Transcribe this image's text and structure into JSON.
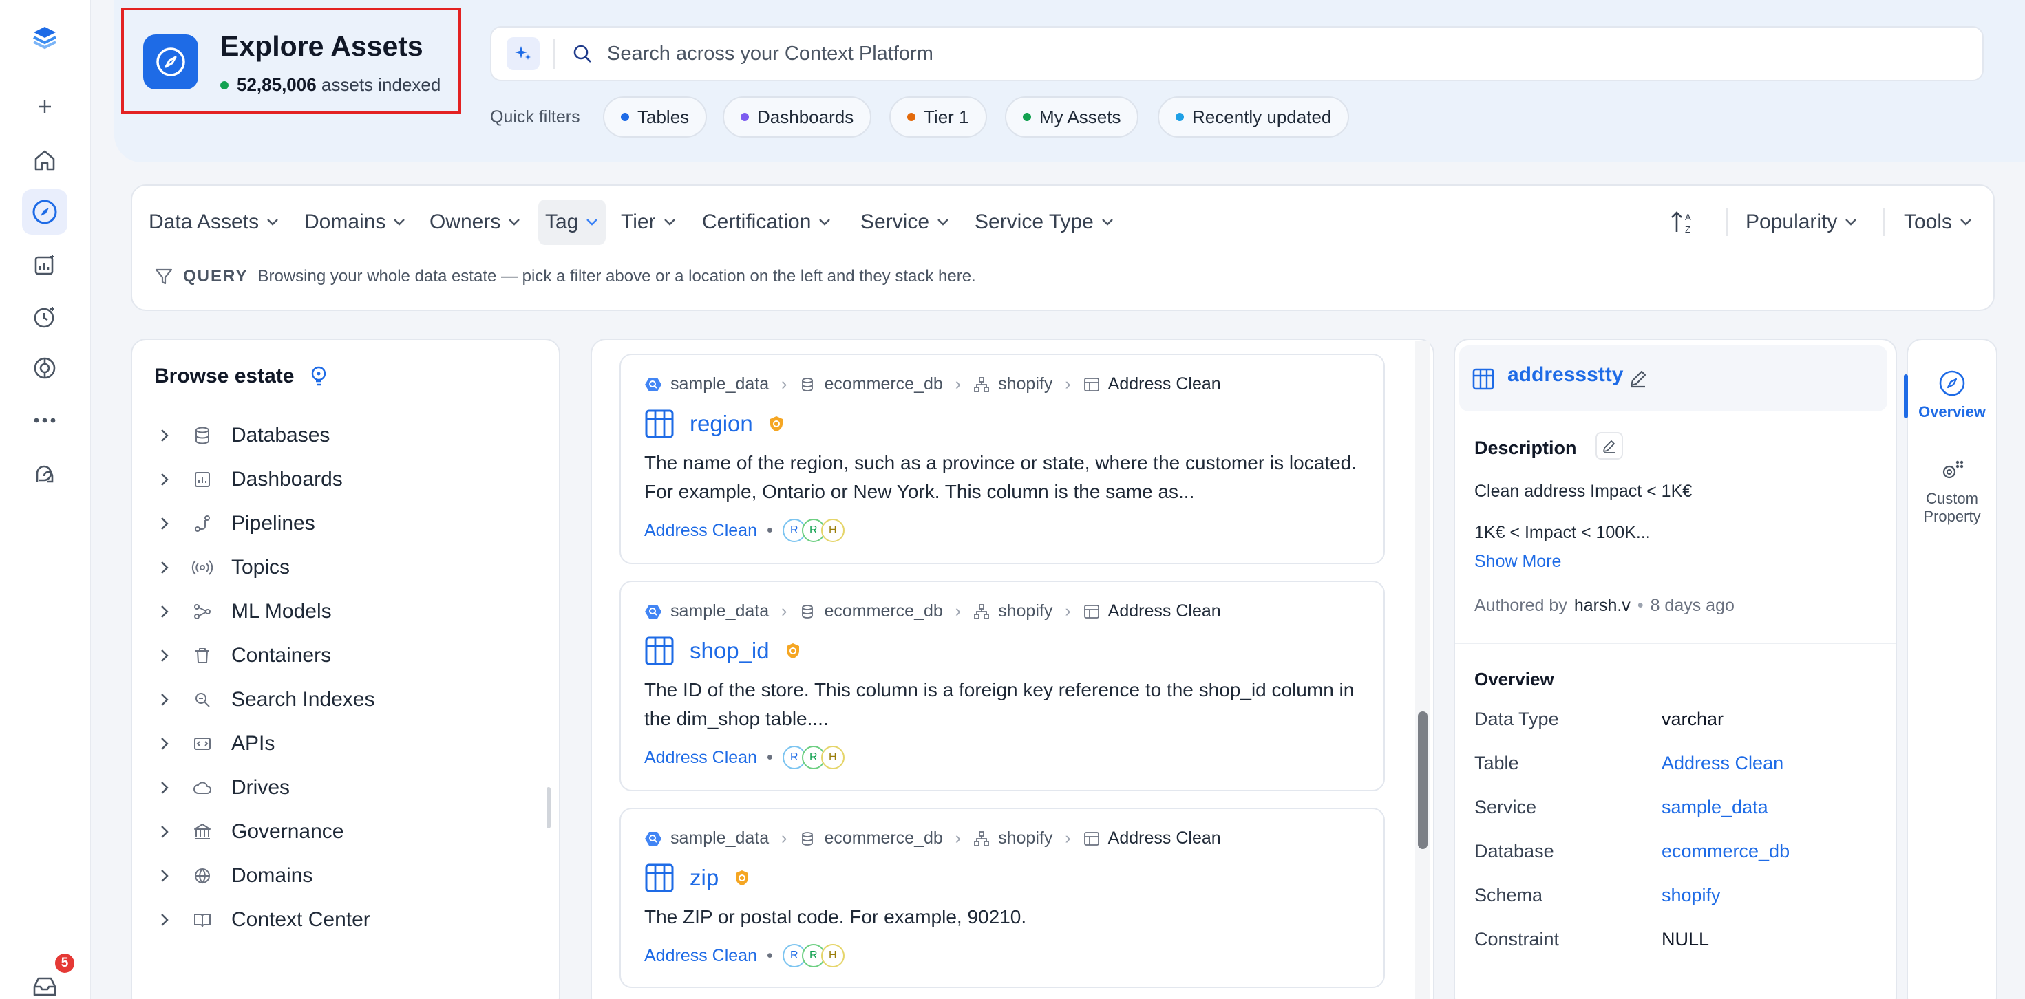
{
  "header": {
    "title": "Explore Assets",
    "indexed_count": "52,85,006",
    "indexed_suffix": "assets indexed"
  },
  "search": {
    "placeholder": "Search across your Context Platform"
  },
  "quick_filters": {
    "label": "Quick filters",
    "chips": [
      {
        "label": "Tables",
        "color": "#1e6be6"
      },
      {
        "label": "Dashboards",
        "color": "#7c5cf0"
      },
      {
        "label": "Tier 1",
        "color": "#e36a0b"
      },
      {
        "label": "My Assets",
        "color": "#12a150"
      },
      {
        "label": "Recently updated",
        "color": "#1ea0e6"
      }
    ]
  },
  "filters": {
    "items": [
      "Data Assets",
      "Domains",
      "Owners",
      "Tag",
      "Tier",
      "Certification",
      "Service",
      "Service Type"
    ],
    "sort": "Popularity",
    "tools": "Tools",
    "query_label": "QUERY",
    "query_text": "Browsing your whole data estate — pick a filter above or a location on the left and they stack here."
  },
  "browse": {
    "title": "Browse estate",
    "items": [
      {
        "label": "Databases",
        "icon": "database-icon"
      },
      {
        "label": "Dashboards",
        "icon": "dashboard-icon"
      },
      {
        "label": "Pipelines",
        "icon": "pipeline-icon"
      },
      {
        "label": "Topics",
        "icon": "topic-icon"
      },
      {
        "label": "ML Models",
        "icon": "ml-model-icon"
      },
      {
        "label": "Containers",
        "icon": "container-icon"
      },
      {
        "label": "Search Indexes",
        "icon": "search-index-icon"
      },
      {
        "label": "APIs",
        "icon": "api-icon"
      },
      {
        "label": "Drives",
        "icon": "cloud-icon"
      },
      {
        "label": "Governance",
        "icon": "governance-icon"
      },
      {
        "label": "Domains",
        "icon": "globe-icon"
      },
      {
        "label": "Context Center",
        "icon": "book-icon"
      }
    ]
  },
  "results": [
    {
      "service": "sample_data",
      "database": "ecommerce_db",
      "schema": "shopify",
      "table": "Address Clean",
      "name": "region",
      "description": "The name of the region, such as a province or state, where the customer is located. For example, Ontario or New York. This column is the same as...",
      "footer_link": "Address Clean",
      "avatars": [
        "R",
        "R",
        "H"
      ]
    },
    {
      "service": "sample_data",
      "database": "ecommerce_db",
      "schema": "shopify",
      "table": "Address Clean",
      "name": "shop_id",
      "description": "The ID of the store. This column is a foreign key reference to the shop_id column in the dim_shop table....",
      "footer_link": "Address Clean",
      "avatars": [
        "R",
        "R",
        "H"
      ]
    },
    {
      "service": "sample_data",
      "database": "ecommerce_db",
      "schema": "shopify",
      "table": "Address Clean",
      "name": "zip",
      "description": "The ZIP or postal code. For example, 90210.",
      "footer_link": "Address Clean",
      "avatars": [
        "R",
        "R",
        "H"
      ]
    }
  ],
  "details": {
    "name": "addressstty",
    "description_label": "Description",
    "description_lines": [
      "Clean address Impact < 1K€",
      "1K€ < Impact < 100K..."
    ],
    "show_more": "Show More",
    "authored_by_label": "Authored by",
    "author": "harsh.v",
    "time_ago": "8 days ago",
    "overview_label": "Overview",
    "rows": [
      {
        "key": "Data Type",
        "value": "varchar",
        "link": false
      },
      {
        "key": "Table",
        "value": "Address Clean",
        "link": true
      },
      {
        "key": "Service",
        "value": "sample_data",
        "link": true
      },
      {
        "key": "Database",
        "value": "ecommerce_db",
        "link": true
      },
      {
        "key": "Schema",
        "value": "shopify",
        "link": true
      },
      {
        "key": "Constraint",
        "value": "NULL",
        "link": false
      }
    ]
  },
  "tabs": [
    {
      "label": "Overview",
      "icon": "compass-icon",
      "active": true
    },
    {
      "label": "Custom Property",
      "icon": "custom-property-icon",
      "active": false
    }
  ],
  "notifications": {
    "count": "5"
  },
  "colors": {
    "accent": "#1e6be6",
    "highlight_border": "#e32222"
  }
}
